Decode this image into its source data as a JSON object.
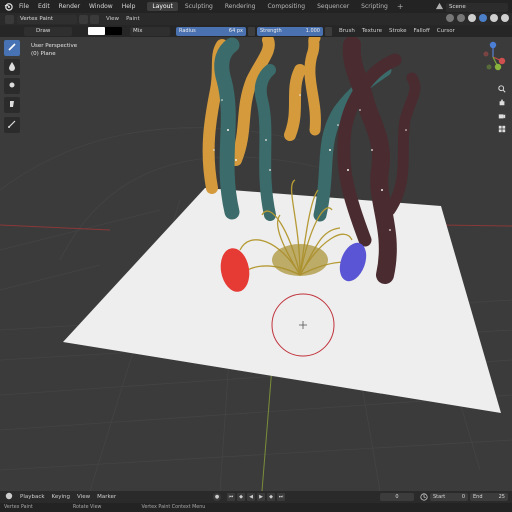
{
  "menu": {
    "items": [
      "File",
      "Edit",
      "Render",
      "Window",
      "Help"
    ],
    "workspaces": [
      "Layout",
      "Sculpting",
      "Rendering",
      "Compositing",
      "Sequencer",
      "Scripting"
    ],
    "active_workspace": "Layout",
    "scene": "Scene"
  },
  "header": {
    "mode": "Vertex Paint",
    "view": "View",
    "paint": "Paint"
  },
  "paint_header": {
    "brush": "Draw",
    "color_primary": "#ffffff",
    "color_secondary": "#000000",
    "blend": "Mix",
    "radius_label": "Radius",
    "radius_value": "64 px",
    "strength_label": "Strength",
    "strength_value": "1.000",
    "menus": [
      "Brush",
      "Texture",
      "Stroke",
      "Falloff",
      "Cursor"
    ]
  },
  "viewport": {
    "perspective": "User Perspective",
    "object": "(0) Plane"
  },
  "timeline": {
    "items": [
      "Playback",
      "Keying",
      "View",
      "Marker"
    ],
    "current_frame": "0",
    "start_label": "Start",
    "start_value": "0",
    "end_label": "End",
    "end_value": "25"
  },
  "statusbar": {
    "items": [
      "Vertex Paint",
      "Rotate View",
      "Vertex Paint Context Menu"
    ]
  },
  "colors": {
    "accent": "#4772b3",
    "ground": "#eeeeee",
    "brush_circle": "#c0333c"
  }
}
